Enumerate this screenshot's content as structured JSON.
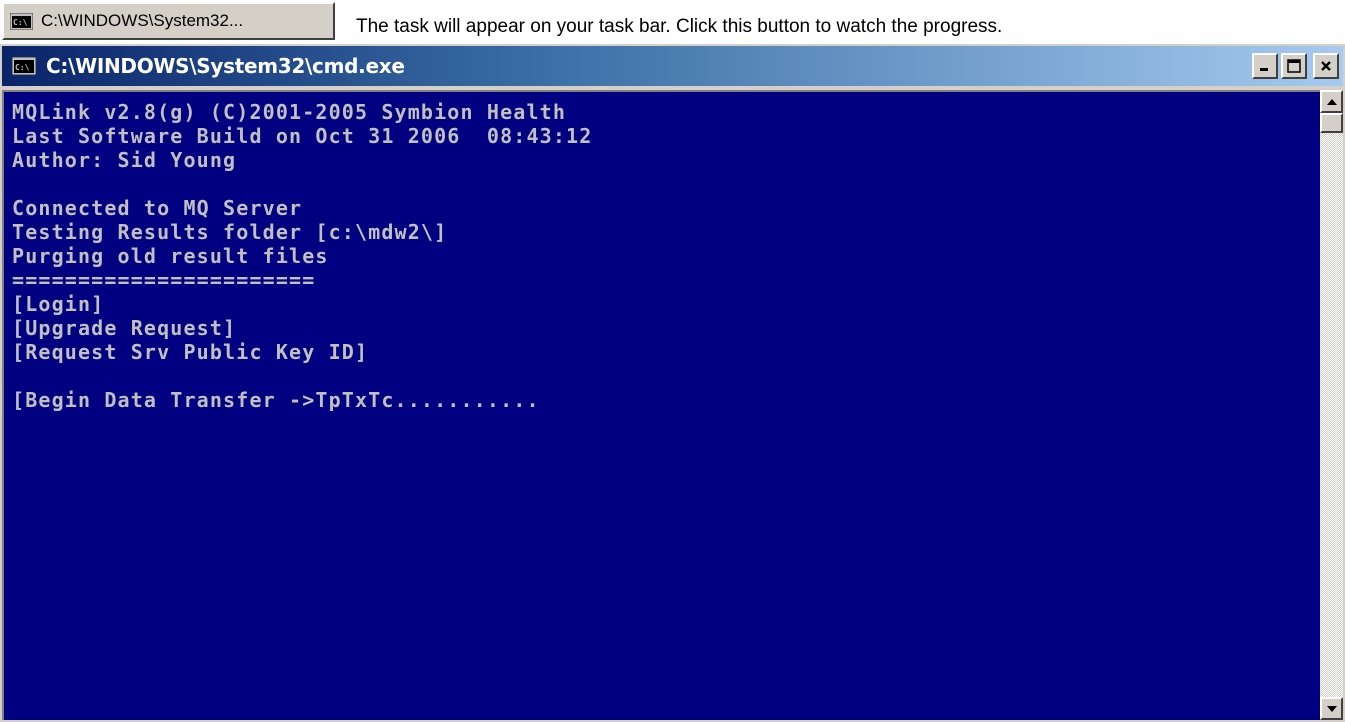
{
  "taskbar_button": {
    "label": "C:\\WINDOWS\\System32...",
    "icon": "cmd-icon"
  },
  "instruction_text": "The task will appear on your task bar. Click this button to watch the progress.",
  "window": {
    "title": "C:\\WINDOWS\\System32\\cmd.exe",
    "icon": "cmd-icon",
    "controls": {
      "minimize": "_",
      "maximize": "□",
      "close": "×"
    }
  },
  "console": {
    "lines": [
      "MQLink v2.8(g) (C)2001-2005 Symbion Health",
      "Last Software Build on Oct 31 2006  08:43:12",
      "Author: Sid Young",
      "",
      "Connected to MQ Server",
      "Testing Results folder [c:\\mdw2\\]",
      "Purging old result files",
      "=======================",
      "[Login]",
      "[Upgrade Request]",
      "[Request Srv Public Key ID]",
      "",
      "[Begin Data Transfer ->TpTxTc..........."
    ]
  },
  "colors": {
    "console_bg": "#000080",
    "console_text": "#c0c0c0",
    "title_gradient_start": "#0a246a",
    "title_gradient_end": "#a6caf0"
  }
}
